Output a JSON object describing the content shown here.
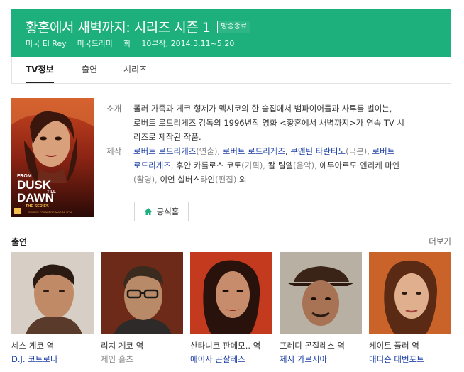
{
  "header": {
    "title": "황혼에서 새벽까지: 시리즈 시즌 1",
    "badge": "방송종료",
    "meta": [
      "미국 El Rey",
      "미국드라마",
      "화",
      "10부작, 2014.3.11~5.20"
    ],
    "bg_color": "#1db07d"
  },
  "tabs": [
    {
      "label": "TV정보",
      "active": true
    },
    {
      "label": "출연",
      "active": false
    },
    {
      "label": "시리즈",
      "active": false
    }
  ],
  "poster": {
    "title_lines": [
      "FROM",
      "DUSK",
      "TILL",
      "DAWN"
    ],
    "subtitle": "THE SERIES",
    "premiere": "SERIES PREMIERE MAR 11 9PM"
  },
  "synopsis": {
    "label": "소개",
    "lines": [
      "폴러 가족과 게코 형제가 멕시코의 한 술집에서 뱀파이어들과 사투를 벌이는,",
      "로버트 로드리게즈 감독의 1996년작 영화 <황혼에서 새벽까지>가 연속 TV 시",
      "리즈로 제작된 작품."
    ]
  },
  "production": {
    "label": "제작",
    "credits": [
      {
        "name": "로버트 로드리게즈",
        "role": "(연출)",
        "link": true
      },
      {
        "name": "로버트 로드리게즈",
        "role": ",",
        "link": true
      },
      {
        "name": "쿠엔틴 타란티노",
        "role": "(극본),",
        "link": true
      },
      {
        "name": "로버트",
        "role": "",
        "link": true
      },
      {
        "name": "로드리게즈",
        "role": ",",
        "link": true
      },
      {
        "name": "후안 카를로스 코토",
        "role": "(기획),",
        "link": false
      },
      {
        "name": "칼 틸엘",
        "role": "(음악),",
        "link": false
      },
      {
        "name": "에두아르도 엔리케 마엔",
        "role": "",
        "link": false
      },
      {
        "name": "",
        "role": "(촬영),",
        "link": false
      },
      {
        "name": "이언 실버스타인",
        "role": "(편집)",
        "link": false
      },
      {
        "name": "외",
        "role": "",
        "link": false
      }
    ]
  },
  "homepage": {
    "label": "공식홈"
  },
  "cast_section": {
    "title": "출연",
    "more": "더보기"
  },
  "cast": [
    {
      "role": "세스 게코 역",
      "actor": "D.J. 코트로나",
      "actor_link": true
    },
    {
      "role": "리치 게코 역",
      "actor": "제인 홀츠",
      "actor_link": false
    },
    {
      "role": "산타니코 판데모.. 역",
      "actor": "에이사 곤살레스",
      "actor_link": true
    },
    {
      "role": "프레디 곤잘레스 역",
      "actor": "제시 가르시아",
      "actor_link": true
    },
    {
      "role": "케이트 풀러 역",
      "actor": "매디슨 대번포트",
      "actor_link": true
    }
  ]
}
